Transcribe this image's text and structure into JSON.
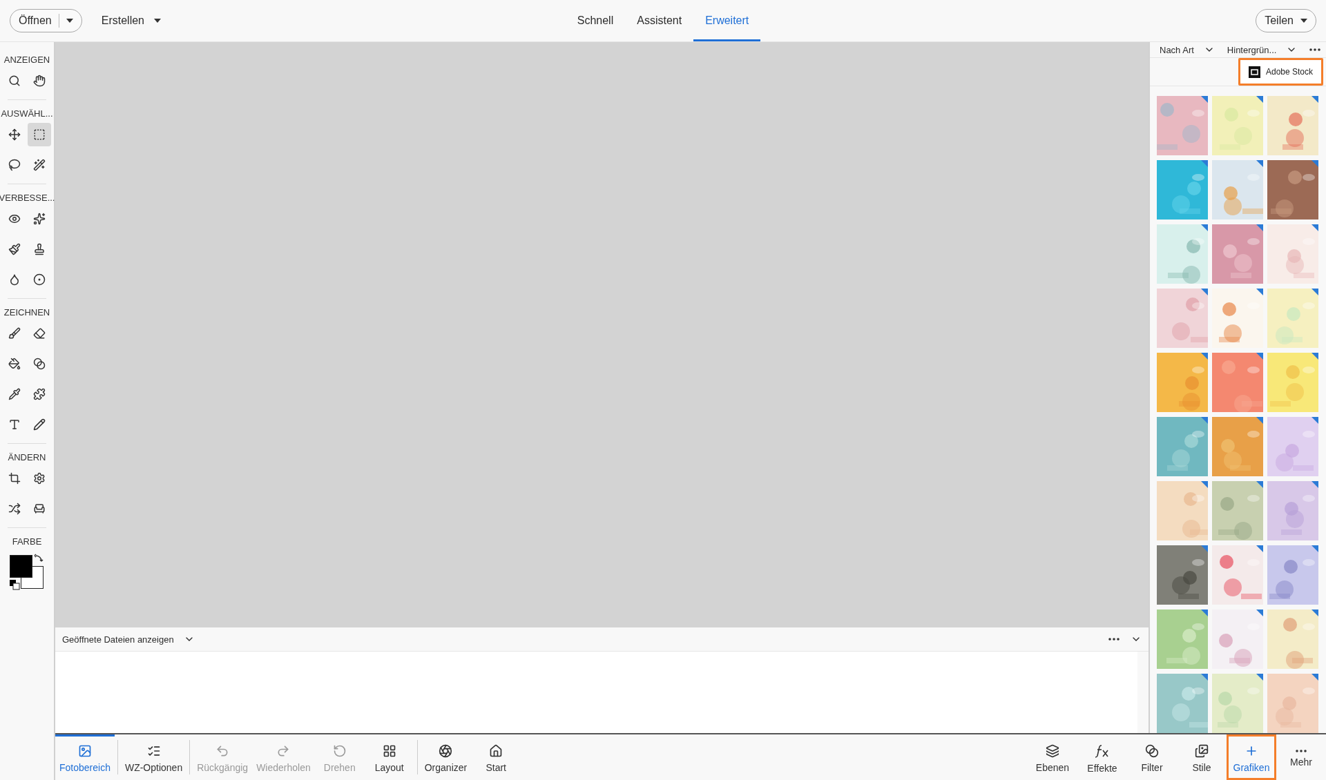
{
  "top_bar": {
    "open_button": {
      "label": "Öffnen"
    },
    "create_menu": {
      "label": "Erstellen"
    },
    "modes": [
      {
        "label": "Schnell",
        "selected": false
      },
      {
        "label": "Assistent",
        "selected": false
      },
      {
        "label": "Erweitert",
        "selected": true
      }
    ],
    "share_button": {
      "label": "Teilen"
    }
  },
  "toolbox": {
    "sections": [
      {
        "title": "ANZEIGEN",
        "tools": [
          {
            "selected": false
          },
          {
            "selected": false
          }
        ]
      },
      {
        "title": "AUSWÄHL...",
        "tools": [
          {
            "selected": false
          },
          {
            "selected": true
          },
          {
            "selected": false
          },
          {
            "selected": false
          }
        ]
      },
      {
        "title": "VERBESSE...",
        "tools": [
          {
            "selected": false
          },
          {
            "selected": false
          },
          {
            "selected": false
          },
          {
            "selected": false
          },
          {
            "selected": false
          },
          {
            "selected": false
          }
        ]
      },
      {
        "title": "ZEICHNEN",
        "tools": [
          {
            "selected": false
          },
          {
            "selected": false
          },
          {
            "selected": false
          },
          {
            "selected": false
          },
          {
            "selected": false
          },
          {
            "selected": false
          },
          {
            "selected": false
          },
          {
            "selected": false
          }
        ]
      },
      {
        "title": "ÄNDERN",
        "tools": [
          {
            "selected": false
          },
          {
            "selected": false
          },
          {
            "selected": false
          },
          {
            "selected": false
          }
        ]
      }
    ],
    "color": {
      "title": "FARBE"
    }
  },
  "photo_bin": {
    "dropdown": {
      "label": "Geöffnete Dateien anzeigen"
    }
  },
  "graphics_panel": {
    "filters": [
      {
        "label": "Nach Art"
      },
      {
        "label": "Hintergrün..."
      }
    ],
    "stock_button": {
      "label": "Adobe Stock",
      "highlighted": true
    }
  },
  "bottom_bar": {
    "left_groups": [
      [
        {
          "label": "Fotobereich",
          "selected": true,
          "disabled": false
        }
      ],
      [
        {
          "label": "WZ-Optionen",
          "selected": false,
          "disabled": false
        }
      ],
      [
        {
          "label": "Rückgängig",
          "selected": false,
          "disabled": true
        },
        {
          "label": "Wiederholen",
          "selected": false,
          "disabled": true
        },
        {
          "label": "Drehen",
          "selected": false,
          "disabled": true
        },
        {
          "label": "Layout",
          "selected": false,
          "disabled": false
        }
      ],
      [
        {
          "label": "Organizer",
          "selected": false,
          "disabled": false
        },
        {
          "label": "Start",
          "selected": false,
          "disabled": false
        }
      ]
    ],
    "right_items": [
      {
        "label": "Ebenen",
        "selected": false,
        "highlighted": false
      },
      {
        "label": "Effekte",
        "selected": false,
        "highlighted": false
      },
      {
        "label": "Filter",
        "selected": false,
        "highlighted": false
      },
      {
        "label": "Stile",
        "selected": false,
        "highlighted": false
      },
      {
        "label": "Grafiken",
        "selected": true,
        "highlighted": true
      },
      {
        "label": "Mehr",
        "selected": false,
        "highlighted": false
      }
    ]
  }
}
